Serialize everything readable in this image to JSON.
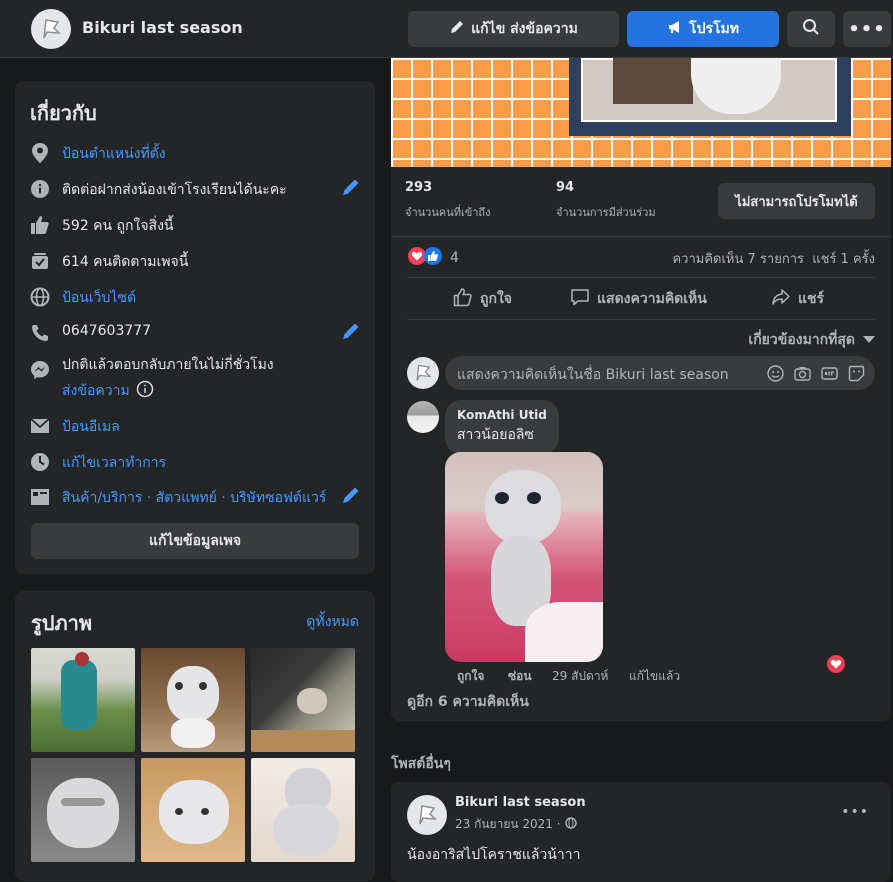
{
  "header": {
    "page_name": "Bikuri last season",
    "edit_send_label": "แก้ไข ส่งข้อความ",
    "promote_label": "โปรโมท"
  },
  "about": {
    "title": "เกี่ยวกับ",
    "items": [
      {
        "icon": "location-pin-icon",
        "text": "ป้อนตำแหน่งที่ตั้ง",
        "link": true
      },
      {
        "icon": "info-icon",
        "text": "ติดต่อฝากส่งน้องเข้าโรงเรียนได้นะคะ",
        "link": false
      },
      {
        "icon": "thumbs-up-icon",
        "text": "592 คน ถูกใจสิ่งนี้",
        "link": false
      },
      {
        "icon": "followers-icon",
        "text": "614 คนติดตามเพจนี้",
        "link": false
      },
      {
        "icon": "globe-icon",
        "text": "ป้อนเว็บไซต์",
        "link": true
      },
      {
        "icon": "phone-icon",
        "text": "0647603777",
        "link": false
      },
      {
        "icon": "messenger-icon",
        "text": "ปกติแล้วตอบกลับภายในไม่กี่ชั่วโมง",
        "sub": "ส่งข้อความ",
        "link": false
      },
      {
        "icon": "mail-icon",
        "text": "ป้อนอีเมล",
        "link": true
      },
      {
        "icon": "clock-icon",
        "text": "แก้ไขเวลาทำการ",
        "link": true
      },
      {
        "icon": "category-icon",
        "text": "สินค้า/บริการ · สัตวแพทย์ · บริษัทซอฟต์แวร์",
        "link": true
      }
    ],
    "edit_page_label": "แก้ไขข้อมูลเพจ"
  },
  "photos": {
    "title": "รูปภาพ",
    "see_all": "ดูทั้งหมด"
  },
  "post": {
    "reach_count": "293",
    "reach_label": "จำนวนคนที่เข้าถึง",
    "engagement_count": "94",
    "engagement_label": "จำนวนการมีส่วนร่วม",
    "cannot_promote": "ไม่สามารถโปรโมทได้",
    "reaction_count": "4",
    "comments_shares": "ความคิดเห็น 7 รายการ  แชร์ 1 ครั้ง",
    "like_label": "ถูกใจ",
    "comment_label": "แสดงความคิดเห็น",
    "share_label": "แชร์",
    "sort_label": "เกี่ยวข้องมากที่สุด",
    "comment_placeholder": "แสดงความคิดเห็นในชื่อ Bikuri last season"
  },
  "comment": {
    "author": "KomAthi Utid",
    "text": "สาวน้อยอลิซ",
    "like": "ถูกใจ",
    "hide": "ซ่อน",
    "time": "29 สัปดาห์",
    "edited": "แก้ไขแล้ว",
    "more": "ดูอีก 6 ความคิดเห็น"
  },
  "other_posts": {
    "title": "โพสต์อื่นๆ",
    "author": "Bikuri last season",
    "date": "23 กันยายน 2021 ·",
    "text": "น้องอาริสไปโคราชแล้วน้าาา"
  },
  "colors": {
    "accent": "#2374e1",
    "link": "#4599ff",
    "bg": "#18191a",
    "card": "#242526"
  }
}
